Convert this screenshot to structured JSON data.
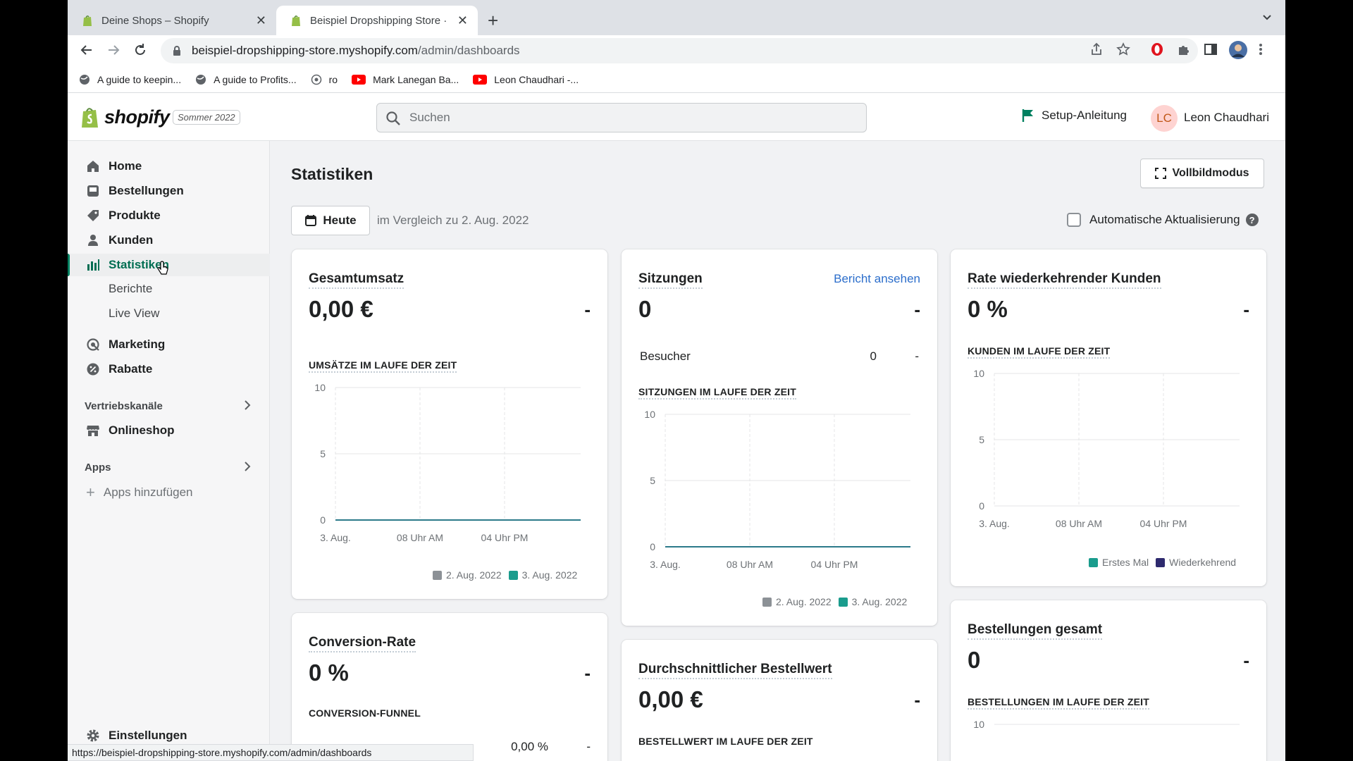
{
  "browser": {
    "tabs": [
      {
        "title": "Deine Shops – Shopify",
        "active": false
      },
      {
        "title": "Beispiel Dropshipping Store · S",
        "active": true
      }
    ],
    "url_host": "beispiel-dropshipping-store.myshopify.com",
    "url_path": "/admin/dashboards",
    "bookmarks": [
      "A guide to keepin...",
      "A guide to Profits...",
      "ro",
      "Mark Lanegan Ba...",
      "Leon Chaudhari -..."
    ],
    "status_url": "https://beispiel-dropshipping-store.myshopify.com/admin/dashboards"
  },
  "topbar": {
    "logo_text": "shopify",
    "edition": "Sommer 2022",
    "search_placeholder": "Suchen",
    "setup_label": "Setup-Anleitung",
    "avatar_initials": "LC",
    "user_name": "Leon Chaudhari"
  },
  "sidebar": {
    "items": [
      {
        "label": "Home",
        "icon": "home-icon"
      },
      {
        "label": "Bestellungen",
        "icon": "orders-icon"
      },
      {
        "label": "Produkte",
        "icon": "tag-icon"
      },
      {
        "label": "Kunden",
        "icon": "person-icon"
      },
      {
        "label": "Statistiken",
        "icon": "analytics-icon",
        "active": true
      },
      {
        "label": "Marketing",
        "icon": "marketing-icon"
      },
      {
        "label": "Rabatte",
        "icon": "discount-icon"
      }
    ],
    "subitems": [
      "Berichte",
      "Live View"
    ],
    "sales_channels_label": "Vertriebskanäle",
    "online_store_label": "Onlineshop",
    "apps_label": "Apps",
    "add_apps_label": "Apps hinzufügen",
    "settings_label": "Einstellungen"
  },
  "main": {
    "title": "Statistiken",
    "fullscreen_label": "Vollbildmodus",
    "date_button": "Heute",
    "comparison": "im Vergleich zu 2. Aug. 2022",
    "auto_refresh_label": "Automatische Aktualisierung",
    "auto_refresh_checked": false
  },
  "cards": {
    "sales": {
      "title": "Gesamtumsatz",
      "value": "0,00 €",
      "change": "-",
      "chart_title": "UMSÄTZE IM LAUFE DER ZEIT",
      "legend": [
        "2. Aug. 2022",
        "3. Aug. 2022"
      ]
    },
    "sessions": {
      "title": "Sitzungen",
      "link": "Bericht ansehen",
      "value": "0",
      "change": "-",
      "visitors_label": "Besucher",
      "visitors_value": "0",
      "visitors_change": "-",
      "chart_title": "SITZUNGEN IM LAUFE DER ZEIT",
      "legend": [
        "2. Aug. 2022",
        "3. Aug. 2022"
      ]
    },
    "returning": {
      "title": "Rate wiederkehrender Kunden",
      "value": "0 %",
      "change": "-",
      "chart_title": "KUNDEN IM LAUFE DER ZEIT",
      "legend": [
        "Erstes Mal",
        "Wiederkehrend"
      ]
    },
    "conversion": {
      "title": "Conversion-Rate",
      "value": "0 %",
      "change": "-",
      "funnel_title": "CONVERSION-FUNNEL",
      "row_value": "0,00 %",
      "row_change": "-"
    },
    "aov": {
      "title": "Durchschnittlicher Bestellwert",
      "value": "0,00 €",
      "change": "-",
      "chart_title": "BESTELLWERT IM LAUFE DER ZEIT"
    },
    "orders": {
      "title": "Bestellungen gesamt",
      "value": "0",
      "change": "-",
      "chart_title": "BESTELLUNGEN IM LAUFE DER ZEIT"
    }
  },
  "colors": {
    "accent_green": "#008060",
    "series_previous": "#8c9196",
    "series_current": "#47c1bf",
    "series_first": "#1a9c8d",
    "series_returning": "#2e2a6e"
  },
  "chart_data": [
    {
      "type": "line",
      "title": "UMSÄTZE IM LAUFE DER ZEIT",
      "x": [
        "3. Aug.",
        "08 Uhr AM",
        "04 Uhr PM"
      ],
      "yticks": [
        0,
        5,
        10
      ],
      "ylim": [
        0,
        10
      ],
      "series": [
        {
          "name": "2. Aug. 2022",
          "values": [
            0,
            0,
            0
          ]
        },
        {
          "name": "3. Aug. 2022",
          "values": [
            0,
            0,
            0
          ]
        }
      ]
    },
    {
      "type": "line",
      "title": "SITZUNGEN IM LAUFE DER ZEIT",
      "x": [
        "3. Aug.",
        "08 Uhr AM",
        "04 Uhr PM"
      ],
      "yticks": [
        0,
        5,
        10
      ],
      "ylim": [
        0,
        10
      ],
      "series": [
        {
          "name": "2. Aug. 2022",
          "values": [
            0,
            0,
            0
          ]
        },
        {
          "name": "3. Aug. 2022",
          "values": [
            0,
            0,
            0
          ]
        }
      ]
    },
    {
      "type": "bar",
      "title": "KUNDEN IM LAUFE DER ZEIT",
      "x": [
        "3. Aug.",
        "08 Uhr AM",
        "04 Uhr PM"
      ],
      "yticks": [
        0,
        5,
        10
      ],
      "ylim": [
        0,
        10
      ],
      "series": [
        {
          "name": "Erstes Mal",
          "values": [
            0,
            0,
            0
          ]
        },
        {
          "name": "Wiederkehrend",
          "values": [
            0,
            0,
            0
          ]
        }
      ]
    },
    {
      "type": "line",
      "title": "BESTELLUNGEN IM LAUFE DER ZEIT",
      "yticks": [
        10
      ]
    }
  ]
}
